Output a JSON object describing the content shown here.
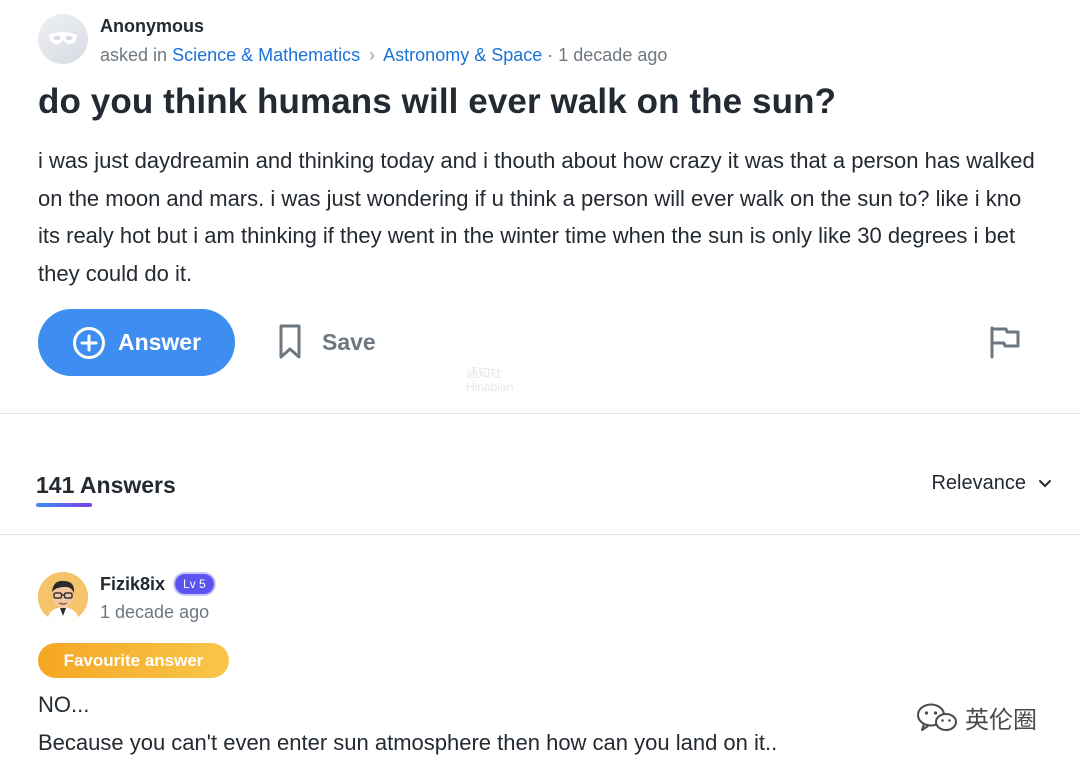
{
  "question": {
    "author": "Anonymous",
    "asked_prefix": "asked in",
    "category": "Science & Mathematics",
    "subcategory": "Astronomy & Space",
    "time": "· 1 decade ago",
    "title": "do you think humans will ever walk on the sun?",
    "body": "i was just daydreamin and thinking today and i thouth about how crazy it was that a person has walked on the moon and mars. i was just wondering if u think a person will ever walk on the sun to? like i kno its realy hot but i am thinking if they went in the winter time when the sun is only like 30 degrees i bet they could do it."
  },
  "actions": {
    "answer_label": "Answer",
    "save_label": "Save"
  },
  "answers": {
    "count_label": "141 Answers",
    "sort_label": "Relevance"
  },
  "top_answer": {
    "author": "Fizik8ix",
    "level": "Lv 5",
    "time": "1 decade ago",
    "badge": "Favourite answer",
    "line1": "NO...",
    "line2": "Because you can't even enter sun atmosphere then how can you land on it.."
  },
  "watermarks": {
    "center_top": "通知社",
    "center_bottom": "Hinablan",
    "corner": "英伦圈"
  },
  "colors": {
    "link": "#1a73d9",
    "primary_button": "#3d8ef0",
    "level_badge": "#5b54f0",
    "favourite_badge": "#f5a623"
  },
  "icons": [
    "anonymous-mask-icon",
    "chevron-right-icon",
    "plus-circle-icon",
    "bookmark-icon",
    "flag-icon",
    "chevron-down-icon",
    "wechat-icon"
  ]
}
